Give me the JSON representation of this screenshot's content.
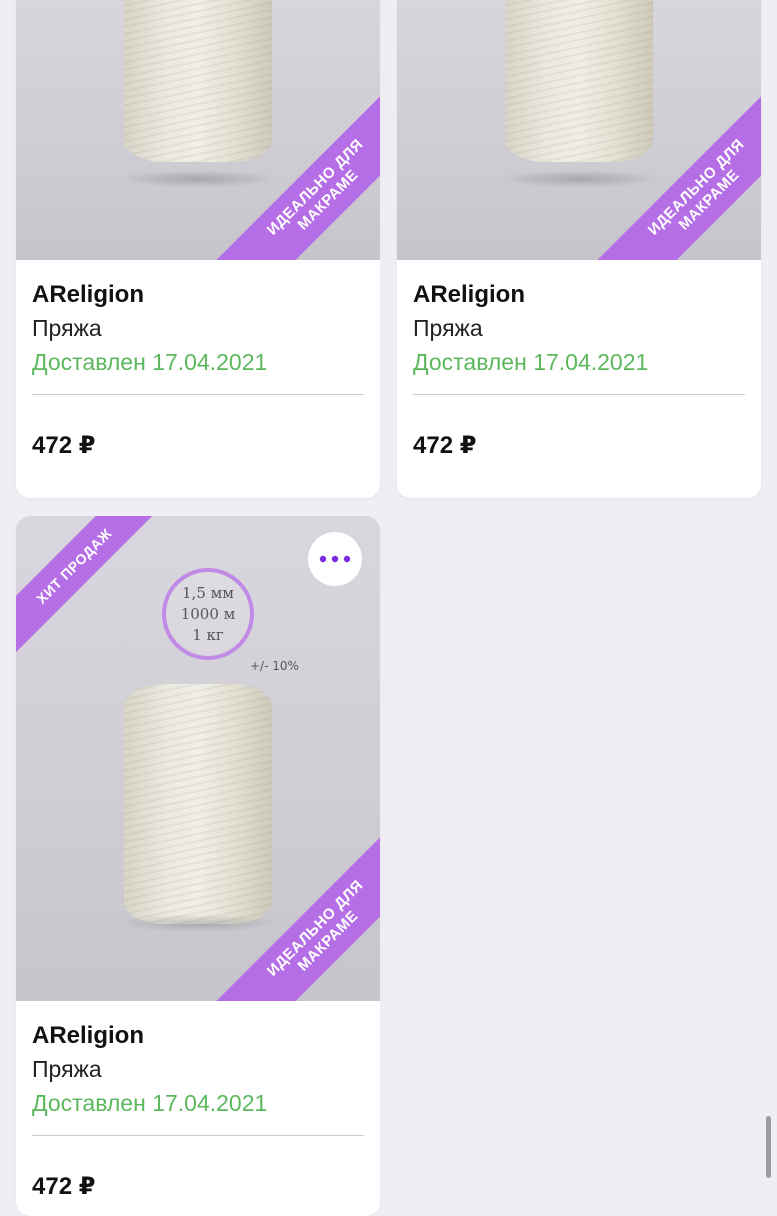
{
  "products": [
    {
      "brand": "AReligion",
      "type": "Пряжа",
      "delivery": "Доставлен 17.04.2021",
      "price": "472 ₽",
      "ribbon_bottom": [
        "Идеально для",
        "макраме"
      ]
    },
    {
      "brand": "AReligion",
      "type": "Пряжа",
      "delivery": "Доставлен 17.04.2021",
      "price": "472 ₽",
      "ribbon_bottom": [
        "Идеально для",
        "макраме"
      ]
    },
    {
      "brand": "AReligion",
      "type": "Пряжа",
      "delivery": "Доставлен 17.04.2021",
      "price": "472 ₽",
      "ribbon_top": "Хит продаж",
      "ribbon_bottom": [
        "Идеально для",
        "макраме"
      ],
      "specs": [
        "1,5 мм",
        "1000 м",
        "1 кг"
      ],
      "tolerance": "+/- 10%",
      "more_icon": "more-horizontal-icon"
    }
  ],
  "colors": {
    "background": "#efeef4",
    "accent_purple": "#b56ee6",
    "delivered_green": "#5cb85c",
    "dots_purple": "#7a2be0"
  }
}
